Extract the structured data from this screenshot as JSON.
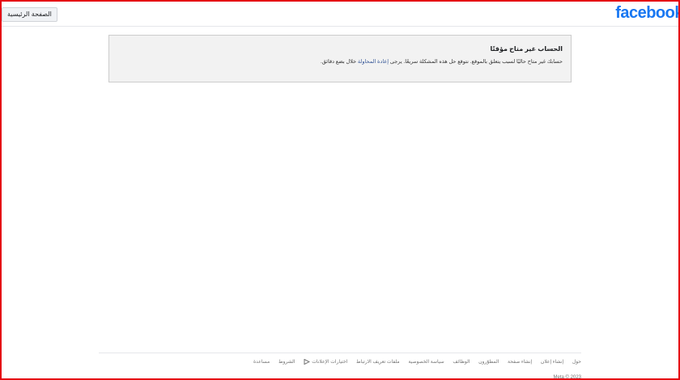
{
  "header": {
    "logo": "facebook",
    "home_button": "الصفحة الرئيسية"
  },
  "message": {
    "title": "الحساب غير متاح مؤقتًا",
    "body_before_link": "حسابك غير متاح حاليًا لسبب يتعلق بالموقع. نتوقع حل هذه المشكلة سريعًا. يرجى",
    "retry_link": "إعادة المحاولة",
    "body_after_link": "خلال بضع دقائق."
  },
  "footer": {
    "links": [
      "حول",
      "إنشاء إعلان",
      "إنشاء صفحة",
      "المطوّرون",
      "الوظائف",
      "سياسة الخصوصية",
      "ملفات تعريف الارتباط",
      "اختيارات الإعلانات",
      "الشروط",
      "مساعدة"
    ],
    "adchoices_icon": "adchoices-icon",
    "copyright": "Meta © 2023"
  },
  "colors": {
    "brand": "#1877f2",
    "link": "#385898",
    "frame_border": "#e50914"
  }
}
